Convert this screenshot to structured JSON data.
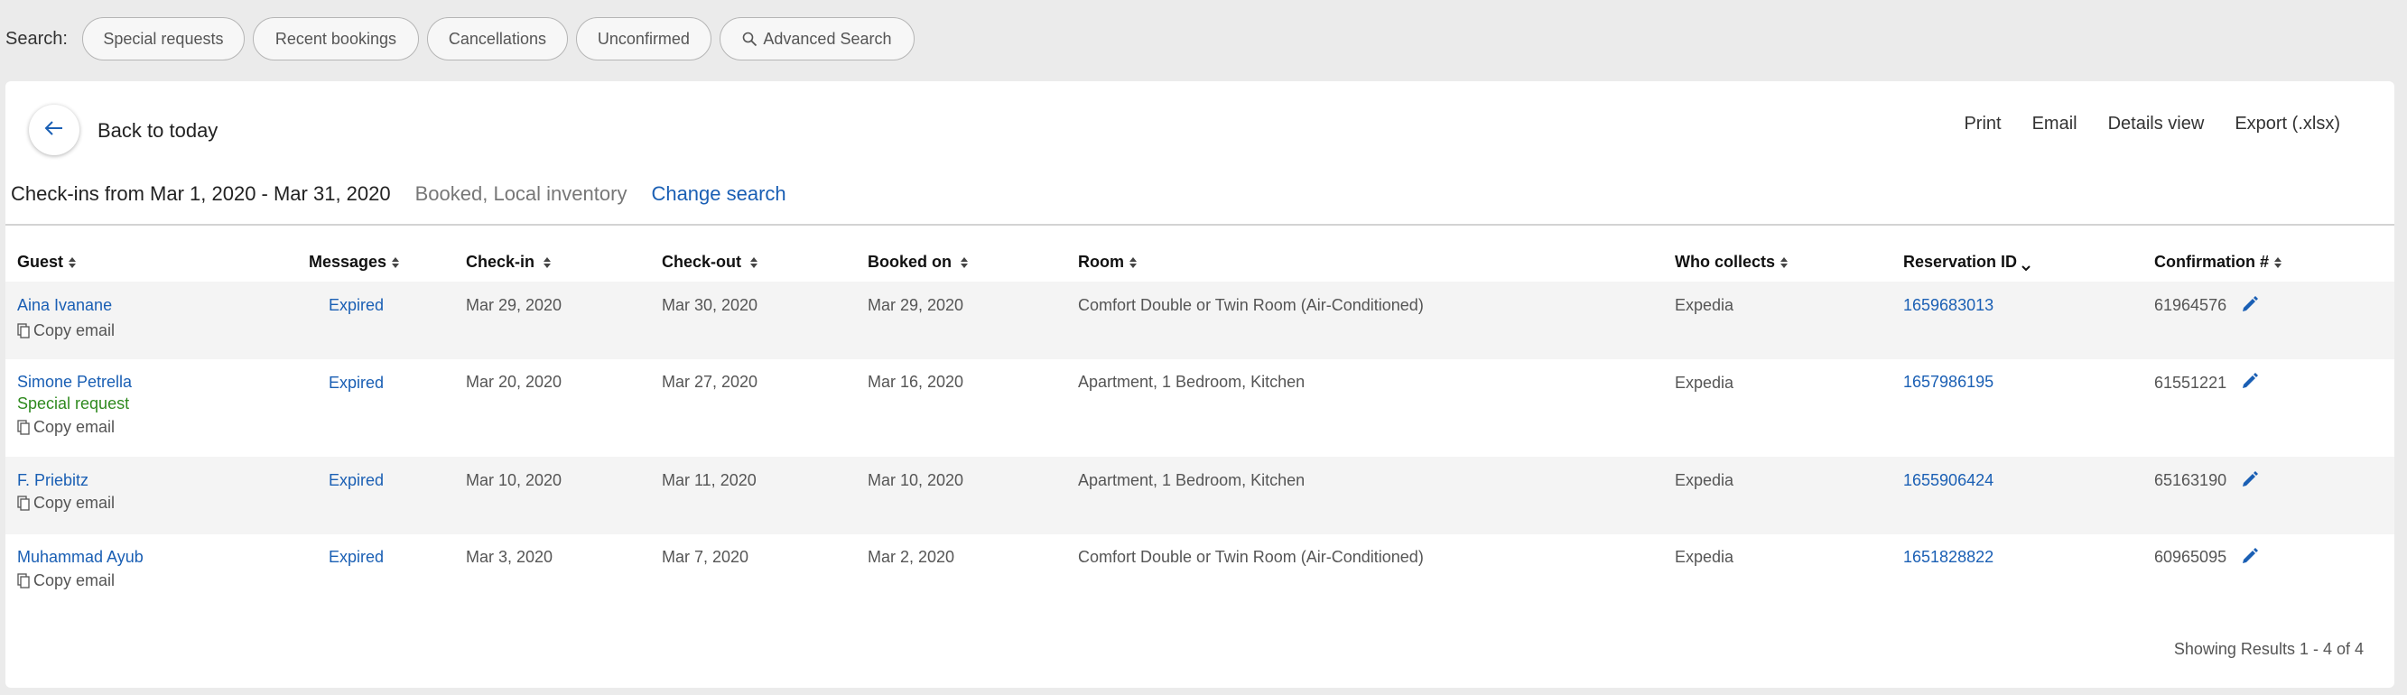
{
  "search": {
    "label": "Search:",
    "pills": [
      "Special requests",
      "Recent bookings",
      "Cancellations",
      "Unconfirmed"
    ],
    "advanced_label": "Advanced Search"
  },
  "header": {
    "back_label": "Back to today",
    "actions": [
      "Print",
      "Email",
      "Details view",
      "Export (.xlsx)"
    ]
  },
  "filter": {
    "range": "Check-ins from Mar 1, 2020 - Mar 31, 2020",
    "status": "Booked, Local inventory",
    "change_link": "Change search"
  },
  "columns": [
    "Guest",
    "Messages",
    "Check-in",
    "Check-out",
    "Booked on",
    "Room",
    "Who collects",
    "Reservation ID",
    "Confirmation #"
  ],
  "copy_email_label": "Copy email",
  "rows": [
    {
      "guest": "Aina Ivanane",
      "special": "",
      "messages": "Expired",
      "checkin": "Mar 29, 2020",
      "checkout": "Mar 30, 2020",
      "booked": "Mar 29, 2020",
      "room": "Comfort Double or Twin Room (Air-Conditioned)",
      "collects": "Expedia",
      "reservation_id": "1659683013",
      "confirmation": "61964576"
    },
    {
      "guest": "Simone Petrella",
      "special": "Special request",
      "messages": "Expired",
      "checkin": "Mar 20, 2020",
      "checkout": "Mar 27, 2020",
      "booked": "Mar 16, 2020",
      "room": "Apartment, 1 Bedroom, Kitchen",
      "collects": "Expedia",
      "reservation_id": "1657986195",
      "confirmation": "61551221"
    },
    {
      "guest": "F. Priebitz",
      "special": "",
      "messages": "Expired",
      "checkin": "Mar 10, 2020",
      "checkout": "Mar 11, 2020",
      "booked": "Mar 10, 2020",
      "room": "Apartment, 1 Bedroom, Kitchen",
      "collects": "Expedia",
      "reservation_id": "1655906424",
      "confirmation": "65163190"
    },
    {
      "guest": "Muhammad Ayub",
      "special": "",
      "messages": "Expired",
      "checkin": "Mar 3, 2020",
      "checkout": "Mar 7, 2020",
      "booked": "Mar 2, 2020",
      "room": "Comfort Double or Twin Room (Air-Conditioned)",
      "collects": "Expedia",
      "reservation_id": "1651828822",
      "confirmation": "60965095"
    }
  ],
  "footer": {
    "results": "Showing Results 1 - 4 of 4"
  },
  "colors": {
    "link": "#1a5fb4",
    "special": "#2f8a1f",
    "row_shade": "#f4f4f4",
    "page_bg": "#ebebeb"
  },
  "icons": [
    "back-arrow-icon",
    "search-icon",
    "sort-icon",
    "chevron-down-icon",
    "copy-icon",
    "pencil-icon"
  ]
}
